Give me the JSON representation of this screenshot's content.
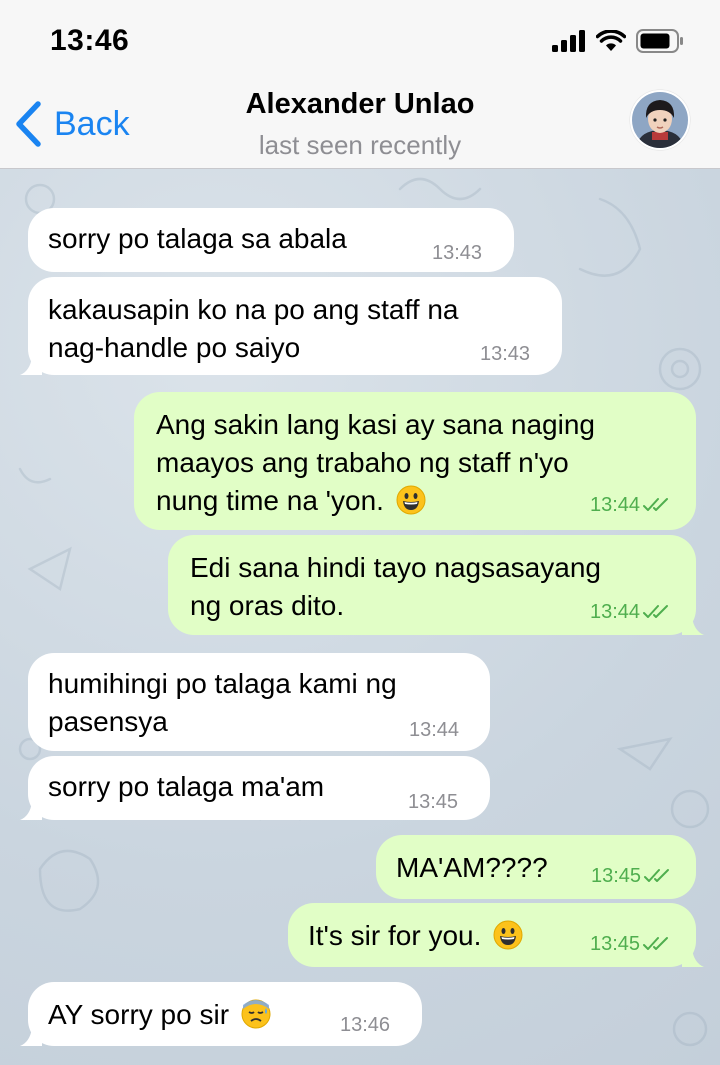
{
  "status": {
    "time": "13:46"
  },
  "header": {
    "back_label": "Back",
    "title": "Alexander Unlao",
    "subtitle": "last seen recently"
  },
  "messages": [
    {
      "dir": "in",
      "lines": [
        "sorry po talaga sa abala"
      ],
      "time": "13:43",
      "emoji": null
    },
    {
      "dir": "in",
      "lines": [
        "kakausapin ko na po ang staff na",
        "nag-handle po saiyo"
      ],
      "time": "13:43",
      "emoji": null
    },
    {
      "dir": "out",
      "lines": [
        "Ang sakin lang kasi ay sana naging",
        "maayos ang trabaho ng staff n'yo",
        "nung time na 'yon."
      ],
      "time": "13:44",
      "emoji": "grinning-face-emoji",
      "read": true
    },
    {
      "dir": "out",
      "lines": [
        "Edi sana hindi tayo nagsasayang",
        "ng oras dito."
      ],
      "time": "13:44",
      "emoji": null,
      "read": true
    },
    {
      "dir": "in",
      "lines": [
        "humihingi po talaga kami ng",
        "pasensya"
      ],
      "time": "13:44",
      "emoji": null
    },
    {
      "dir": "in",
      "lines": [
        "sorry po talaga ma'am"
      ],
      "time": "13:45",
      "emoji": null
    },
    {
      "dir": "out",
      "lines": [
        "MA'AM????"
      ],
      "time": "13:45",
      "emoji": null,
      "read": true
    },
    {
      "dir": "out",
      "lines": [
        "It's sir for you."
      ],
      "time": "13:45",
      "emoji": "grinning-face-emoji",
      "read": true
    },
    {
      "dir": "in",
      "lines": [
        "AY sorry po sir"
      ],
      "time": "13:46",
      "emoji": "downcast-sweat-face-emoji"
    }
  ],
  "colors": {
    "accent": "#1a84f1",
    "incoming_bubble": "#ffffff",
    "outgoing_bubble": "#e1fec6",
    "outgoing_time": "#4fae4e",
    "incoming_time": "#8e8e93"
  },
  "icons": [
    "signal-icon",
    "wifi-icon",
    "battery-icon",
    "chevron-left-icon",
    "double-check-icon"
  ]
}
